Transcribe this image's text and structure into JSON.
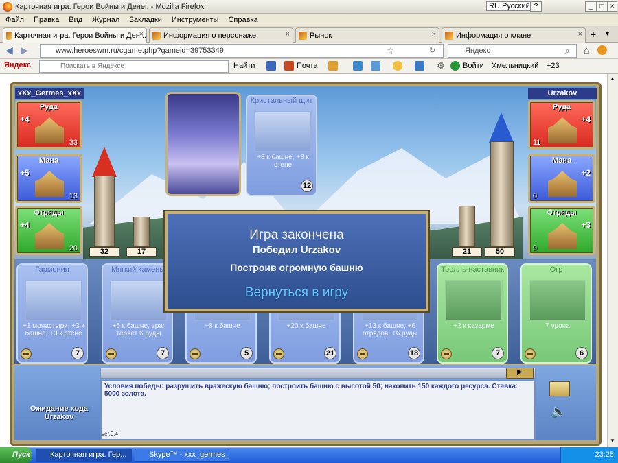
{
  "window": {
    "title": "Карточная игра. Герои Войны и Денег. - Mozilla Firefox",
    "lang_indicator": "RU Русский"
  },
  "menu": [
    "Файл",
    "Правка",
    "Вид",
    "Журнал",
    "Закладки",
    "Инструменты",
    "Справка"
  ],
  "tabs": [
    {
      "label": "Карточная игра. Герои Войны и Ден..."
    },
    {
      "label": "Информация о персонаже."
    },
    {
      "label": "Рынок"
    },
    {
      "label": "Информация о клане"
    }
  ],
  "nav": {
    "url": "www.heroeswm.ru/cgame.php?gameid=39753349",
    "search_placeholder": "Яндекс"
  },
  "yandex": {
    "logo": "Яндекс",
    "search_placeholder": "Поискать в Яндексе",
    "find_label": "Найти",
    "mail_label": "Почта",
    "login_label": "Войти",
    "city": "Хмельницкий",
    "temp": "+23"
  },
  "game": {
    "left_player": {
      "name": "xXx_Germes_xXx",
      "resources": [
        {
          "label": "Руда",
          "delta": "+4",
          "count": "33"
        },
        {
          "label": "Мана",
          "delta": "+5",
          "count": "13"
        },
        {
          "label": "Отряды",
          "delta": "+4",
          "count": "20"
        }
      ],
      "tower": "32",
      "wall": "17"
    },
    "right_player": {
      "name": "Urzakov",
      "resources": [
        {
          "label": "Руда",
          "delta": "+4",
          "count": "11"
        },
        {
          "label": "Мана",
          "delta": "+2",
          "count": "0"
        },
        {
          "label": "Отряды",
          "delta": "+3",
          "count": "9"
        }
      ],
      "tower": "50",
      "wall": "21"
    },
    "played_card": {
      "name": "Кристальный щит",
      "desc": "+8 к башне, +3 к стене",
      "cost": "12"
    },
    "hand": [
      {
        "name": "Гармония",
        "desc": "+1 монастыри, +3 к башне, +3 к стене",
        "cost": "7",
        "type": "blue"
      },
      {
        "name": "Мягкий камень",
        "desc": "+5 к башне, враг теряет 6 руды",
        "cost": "7",
        "type": "blue"
      },
      {
        "name": "",
        "desc": "+8 к башне",
        "cost": "5",
        "type": "blue"
      },
      {
        "name": "",
        "desc": "+20 к башне",
        "cost": "21",
        "type": "blue"
      },
      {
        "name": "",
        "desc": "+13 к башне, +6 отрядов, +6 руды",
        "cost": "18",
        "type": "blue"
      },
      {
        "name": "Тролль-наставник",
        "desc": "+2 к казарме",
        "cost": "7",
        "type": "green"
      },
      {
        "name": "Огр",
        "desc": "7 урона",
        "cost": "6",
        "type": "green"
      }
    ],
    "modal": {
      "title": "Игра закончена",
      "winner": "Победил Urzakov",
      "reason": "Построив огромную башню",
      "return_link": "Вернуться в игру"
    },
    "log_text": "Условия победы: разрушить вражескую башню; построить башню с высотой 50; накопить 150 каждого ресурса. Ставка: 5000 золота.",
    "status": "Ожидание хода Urzakov",
    "version": "ver.0.4"
  },
  "taskbar": {
    "start": "Пуск",
    "items": [
      {
        "label": "Карточная игра. Гер..."
      },
      {
        "label": "Skype™ - xxx_germes_xxx"
      }
    ],
    "clock": "23:25"
  },
  "colors": {
    "accent": "#2e5cd8",
    "red": "#e03a2e",
    "blue": "#4a6ae0",
    "green": "#3ab03a"
  }
}
